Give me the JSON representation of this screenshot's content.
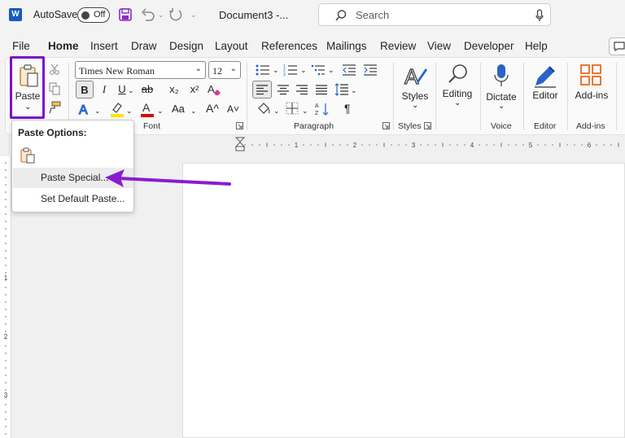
{
  "titlebar": {
    "app_icon": "W",
    "autosave_label": "AutoSave",
    "autosave_state": "Off",
    "document_title": "Document3  -...",
    "search_placeholder": "Search"
  },
  "menu_tabs": [
    "File",
    "Home",
    "Insert",
    "Draw",
    "Design",
    "Layout",
    "References",
    "Mailings",
    "Review",
    "View",
    "Developer",
    "Help"
  ],
  "active_tab": "Home",
  "ribbon": {
    "clipboard": {
      "paste_label": "Paste"
    },
    "font": {
      "font_name": "Times New Roman",
      "font_size": "12",
      "bold": "B",
      "italic": "I",
      "underline": "U",
      "strike": "ab",
      "subscript": "x₂",
      "superscript": "x²",
      "change_case": "Aa",
      "grow": "A^",
      "shrink": "A˅",
      "group_label": "Font"
    },
    "paragraph": {
      "group_label": "Paragraph",
      "pilcrow": "¶"
    },
    "styles": {
      "button_label": "Styles",
      "group_label": "Styles"
    },
    "editing": {
      "button_label": "Editing"
    },
    "voice": {
      "button_label": "Dictate",
      "group_label": "Voice"
    },
    "editor": {
      "button_label": "Editor",
      "group_label": "Editor"
    },
    "addins": {
      "button_label": "Add-ins",
      "group_label": "Add-ins"
    }
  },
  "ruler": {
    "marks": [
      "1",
      "2",
      "3",
      "4",
      "5",
      "6"
    ],
    "vmarks": [
      "1",
      "2",
      "3"
    ]
  },
  "paste_menu": {
    "title": "Paste Options:",
    "items": [
      "Paste Special...",
      "Set Default Paste..."
    ]
  },
  "colors": {
    "accent": "#185abd",
    "highlight": "#7a12c9",
    "arrow": "#8a1ccf",
    "font_color_bar": "#e00000",
    "highlight_bar": "#ffe300"
  }
}
